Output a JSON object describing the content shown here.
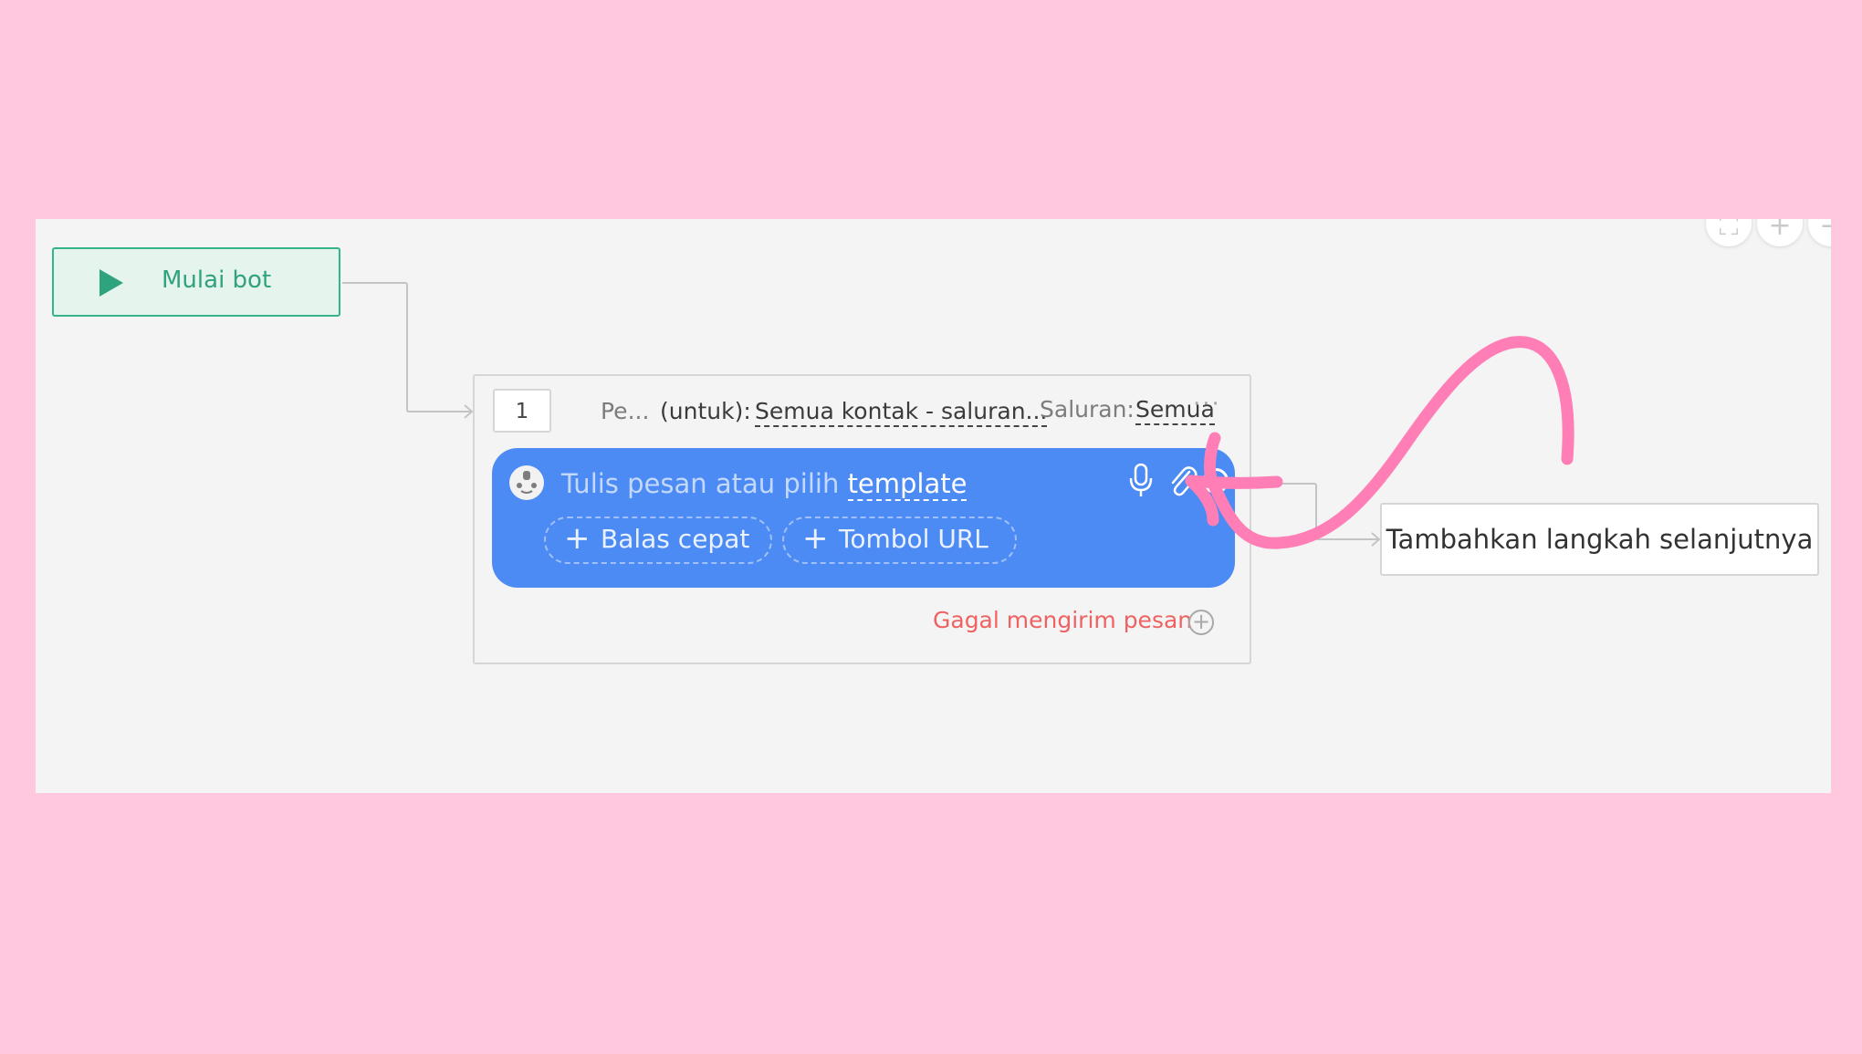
{
  "canvas": {
    "zoom_controls": [
      {
        "name": "fit-screen-button",
        "glyph": "⛶"
      },
      {
        "name": "zoom-in-button",
        "glyph": "+"
      },
      {
        "name": "zoom-out-button",
        "glyph": "−"
      }
    ]
  },
  "start_node": {
    "label": "Mulai bot",
    "icon": "play-icon",
    "color": "#34b48c"
  },
  "step": {
    "number": "1",
    "title": "Pe...",
    "for_label": "(untuk):",
    "audience": "Semua kontak - saluran...",
    "channel_label": "Saluran:",
    "channel_value": "Semua",
    "more": "···",
    "message": {
      "placeholder": "Tulis pesan atau pilih",
      "template_link": "template",
      "color": "#4d8bf4",
      "icons": [
        "mic-icon",
        "paperclip-icon",
        "emoji-icon"
      ]
    },
    "buttons": [
      {
        "label": "Balas cepat"
      },
      {
        "label": "Tombol URL"
      }
    ],
    "fail_label": "Gagal mengirim pesan"
  },
  "next_step": {
    "label": "Tambahkan langkah selanjutnya"
  },
  "annotation": {
    "color": "#ff7eb6"
  }
}
